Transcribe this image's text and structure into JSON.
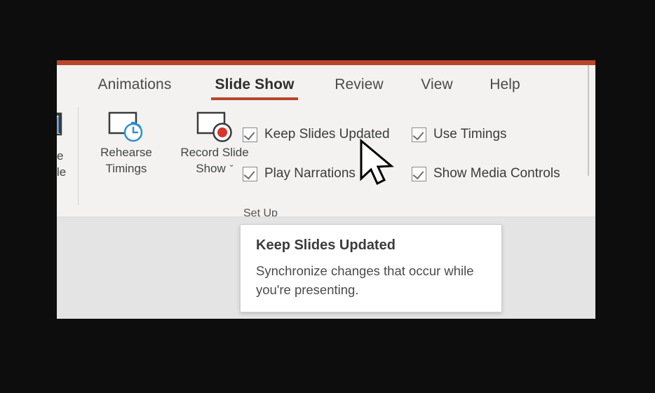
{
  "window": {
    "accent_color": "#b7472a",
    "ribbon_bg": "#f3f2f1",
    "canvas_bg": "#e4e4e4"
  },
  "tabs": [
    {
      "label": "Animations",
      "active": false
    },
    {
      "label": "Slide Show",
      "active": true
    },
    {
      "label": "Review",
      "active": false
    },
    {
      "label": "View",
      "active": false
    },
    {
      "label": "Help",
      "active": false
    }
  ],
  "clipped_button": {
    "line1": "e",
    "line2": "le",
    "icon": "present-online-icon"
  },
  "big_buttons": [
    {
      "line1": "Rehearse",
      "line2": "Timings",
      "icon": "rehearse-timings-icon"
    },
    {
      "line1": "Record Slide",
      "line2": "Show",
      "dropdown": "ˇ",
      "icon": "record-slide-show-icon"
    }
  ],
  "checkboxes": [
    {
      "label": "Keep Slides Updated",
      "checked": true
    },
    {
      "label": "Play Narrations",
      "checked": true
    },
    {
      "label": "Use Timings",
      "checked": true
    },
    {
      "label": "Show Media Controls",
      "checked": true
    }
  ],
  "group_title": "Set Up",
  "tooltip": {
    "title": "Keep Slides Updated",
    "body": "Synchronize changes that occur while you're presenting."
  },
  "cursor": {
    "name": "mouse-pointer"
  }
}
